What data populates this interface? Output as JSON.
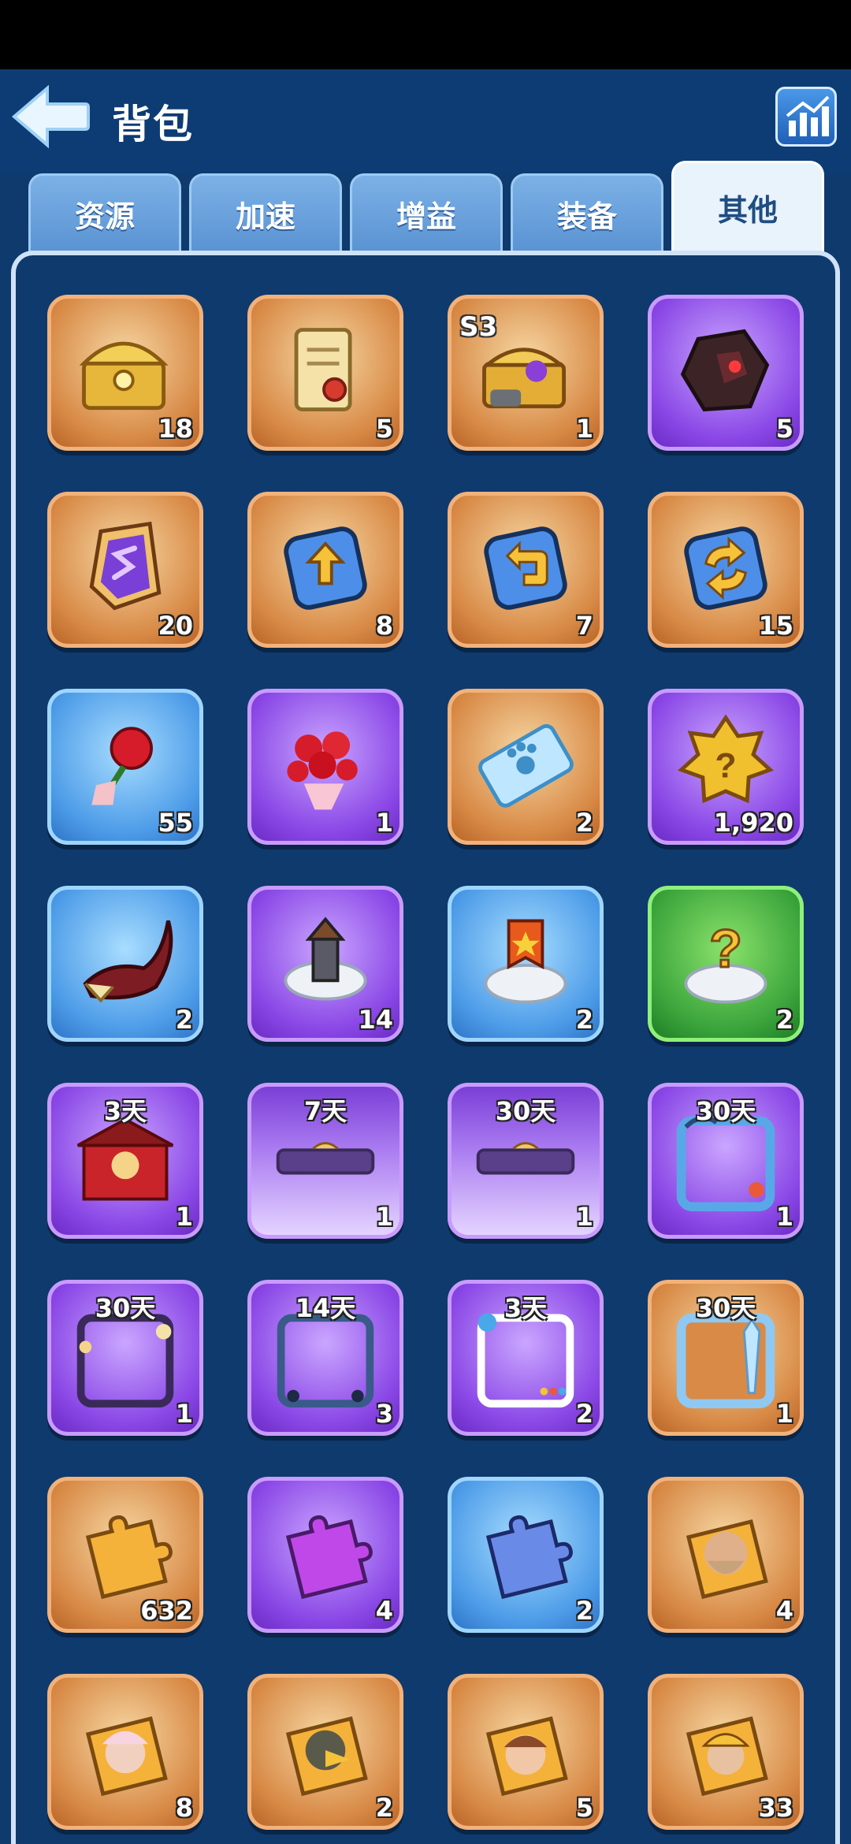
{
  "header": {
    "title": "背包",
    "back_icon": "back-arrow-icon",
    "stats_icon": "bar-chart-icon"
  },
  "tabs": [
    {
      "label": "资源",
      "active": false
    },
    {
      "label": "加速",
      "active": false
    },
    {
      "label": "增益",
      "active": false
    },
    {
      "label": "装备",
      "active": false
    },
    {
      "label": "其他",
      "active": true
    }
  ],
  "items": [
    {
      "icon": "golden-treasure-chest-icon",
      "rarity": "orange",
      "qty": "18"
    },
    {
      "icon": "scroll-with-seal-icon",
      "rarity": "orange",
      "qty": "5"
    },
    {
      "icon": "s3-treasure-chest-icon",
      "rarity": "orange",
      "qty": "1",
      "badge": "S3"
    },
    {
      "icon": "dark-crystal-stone-icon",
      "rarity": "purple",
      "qty": "5"
    },
    {
      "icon": "purple-rune-card-icon",
      "rarity": "orange",
      "qty": "20"
    },
    {
      "icon": "upgrade-arrow-card-icon",
      "rarity": "orange",
      "qty": "8"
    },
    {
      "icon": "return-arrow-card-icon",
      "rarity": "orange",
      "qty": "7"
    },
    {
      "icon": "swap-arrows-card-icon",
      "rarity": "orange",
      "qty": "15"
    },
    {
      "icon": "single-rose-icon",
      "rarity": "blue",
      "qty": "55"
    },
    {
      "icon": "rose-bouquet-icon",
      "rarity": "purple",
      "qty": "1"
    },
    {
      "icon": "paw-ticket-icon",
      "rarity": "orange",
      "qty": "2"
    },
    {
      "icon": "mystery-badge-icon",
      "rarity": "purple",
      "qty": "1,920"
    },
    {
      "icon": "horn-icon",
      "rarity": "blue",
      "qty": "2"
    },
    {
      "icon": "tower-relocate-icon",
      "rarity": "purple",
      "qty": "14"
    },
    {
      "icon": "banner-relocate-icon",
      "rarity": "blue",
      "qty": "2"
    },
    {
      "icon": "random-relocate-icon",
      "rarity": "green",
      "qty": "2"
    },
    {
      "icon": "red-palace-skin-icon",
      "rarity": "purple",
      "qty": "1",
      "duration": "3天"
    },
    {
      "icon": "nameplate-skin-icon",
      "rarity": "purple-frame",
      "qty": "1",
      "duration": "7天"
    },
    {
      "icon": "nameplate-skin-icon",
      "rarity": "purple-frame",
      "qty": "1",
      "duration": "30天"
    },
    {
      "icon": "ocean-avatar-frame-icon",
      "rarity": "purple",
      "qty": "1",
      "duration": "30天"
    },
    {
      "icon": "garden-avatar-frame-icon",
      "rarity": "purple",
      "qty": "1",
      "duration": "30天"
    },
    {
      "icon": "night-avatar-frame-icon",
      "rarity": "purple",
      "qty": "3",
      "duration": "14天"
    },
    {
      "icon": "social-avatar-frame-icon",
      "rarity": "purple",
      "qty": "2",
      "duration": "3天"
    },
    {
      "icon": "ice-avatar-frame-icon",
      "rarity": "orange",
      "qty": "1",
      "duration": "30天"
    },
    {
      "icon": "orange-puzzle-piece-icon",
      "rarity": "orange",
      "qty": "632"
    },
    {
      "icon": "purple-puzzle-piece-icon",
      "rarity": "purple",
      "qty": "4"
    },
    {
      "icon": "blue-puzzle-piece-icon",
      "rarity": "blue",
      "qty": "2"
    },
    {
      "icon": "hero-puzzle-bearded-icon",
      "rarity": "orange",
      "qty": "4"
    },
    {
      "icon": "hero-puzzle-pink-hair-icon",
      "rarity": "orange",
      "qty": "8"
    },
    {
      "icon": "hero-puzzle-bird-icon",
      "rarity": "orange",
      "qty": "2"
    },
    {
      "icon": "hero-puzzle-brown-hair-icon",
      "rarity": "orange",
      "qty": "5"
    },
    {
      "icon": "hero-puzzle-miner-icon",
      "rarity": "orange",
      "qty": "33"
    }
  ]
}
